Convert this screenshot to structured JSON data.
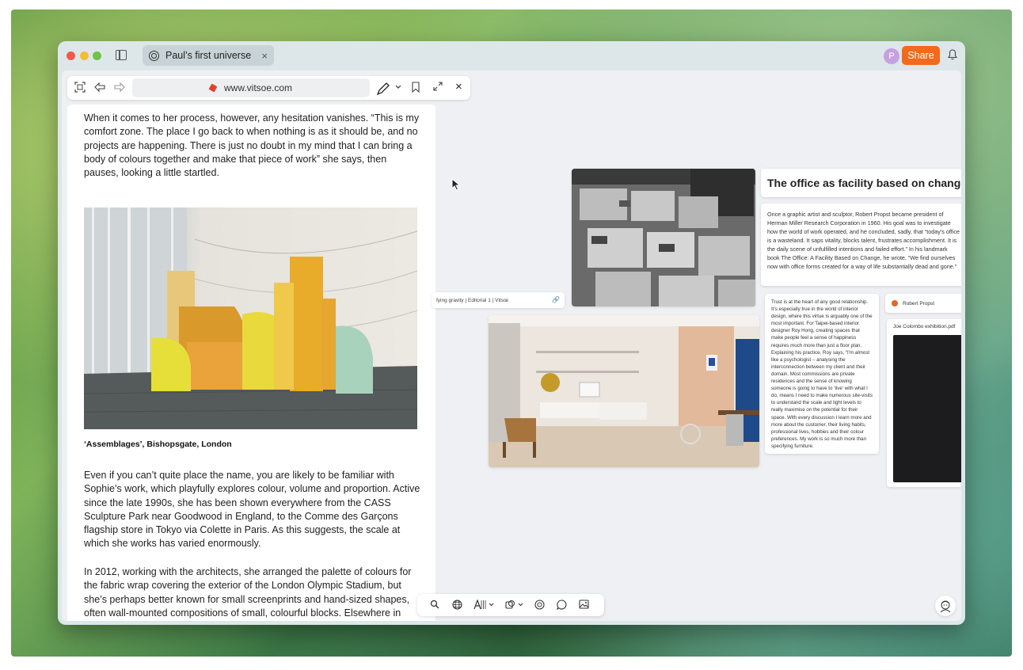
{
  "window": {
    "tab_title": "Paul’s first universe",
    "tab_close": "×",
    "avatar_initial": "P",
    "share_label": "Share",
    "accent_color": "#f26a1b"
  },
  "browser": {
    "url": "www.vitsoe.com",
    "close": "×",
    "icons": [
      "focus-icon",
      "back-icon",
      "forward-icon",
      "pen-icon",
      "chevron-down-icon",
      "bookmark-icon",
      "expand-icon",
      "close-icon"
    ]
  },
  "article": {
    "para1": "When it comes to her process, however, any hesitation vanishes. “This is my comfort zone. The place I go back to when nothing is as it should be, and no projects are happening. There is just no doubt in my mind that I can bring a body of colours together and make that piece of work” she says, then pauses, looking a little startled.",
    "caption": "‘Assemblages’, Bishopsgate, London",
    "para2": "Even if you can’t quite place the name, you are likely to be familiar with Sophie’s work, which playfully explores colour, volume and proportion. Active since the late 1990s, she has been shown everywhere from the CASS Sculpture Park near Goodwood in England, to the Comme des Garçons flagship store in Tokyo via Colette in Paris. As this suggests, the scale at which she works has varied enormously.",
    "para3": "In 2012, working with the architects, she arranged the palette of colours for the fabric wrap covering the exterior of the London Olympic Stadium, but she’s perhaps better known for small screenprints and hand-sized shapes, often wall-mounted compositions of small, colourful blocks. Elsewhere in"
  },
  "canvas": {
    "link_card": "fying gravity | Editorial 1 | Vitsœ",
    "heading": "The office as facility based on change",
    "text1": "Once a graphic artist and sculptor, Robert Propst became president of Herman Miller Research Corporation in 1960. His goal was to investigate how the world of work operated, and he concluded, sadly, that “today’s office is a wasteland. It saps vitality, blocks talent, frustrates accomplishment. It is the daily scene of unfulfilled intentions and failed effort.” In his landmark book The Office: A Facility Based on Change, he wrote, “We find ourselves now with office forms created for a way of life substantially dead and gone.”",
    "text2": "Trust is at the heart of any good relationship. It’s especially true in the world of interior design, where this virtue is arguably one of the most important. For Taipei-based interior designer Roy Hong, creating spaces that make people feel a sense of happiness requires much more than just a floor plan. Explaining his practice, Roy says, “I’m almost like a psychologist – analysing the interconnection between my client and their domain. Most commissions are private residences and the sense of knowing someone is going to have to ‘live’ with what I do, means I need to make numerous site-visits to understand the scale and light levels to really maximise on the potential for their space. With every discussion I learn more and more about the customer, their living habits, professional lives, hobbies and their colour preferences. My work is so much more than specifying furniture.",
    "person": "Robert Propst",
    "pdf_title": "Joe Colombo exhibition.pdf"
  },
  "bottom_toolbar": {
    "icons": [
      "search-icon",
      "globe-icon",
      "text-style-icon",
      "chevron-down-icon",
      "shapes-icon",
      "chevron-down-icon",
      "universe-icon",
      "comment-icon",
      "image-icon"
    ]
  }
}
